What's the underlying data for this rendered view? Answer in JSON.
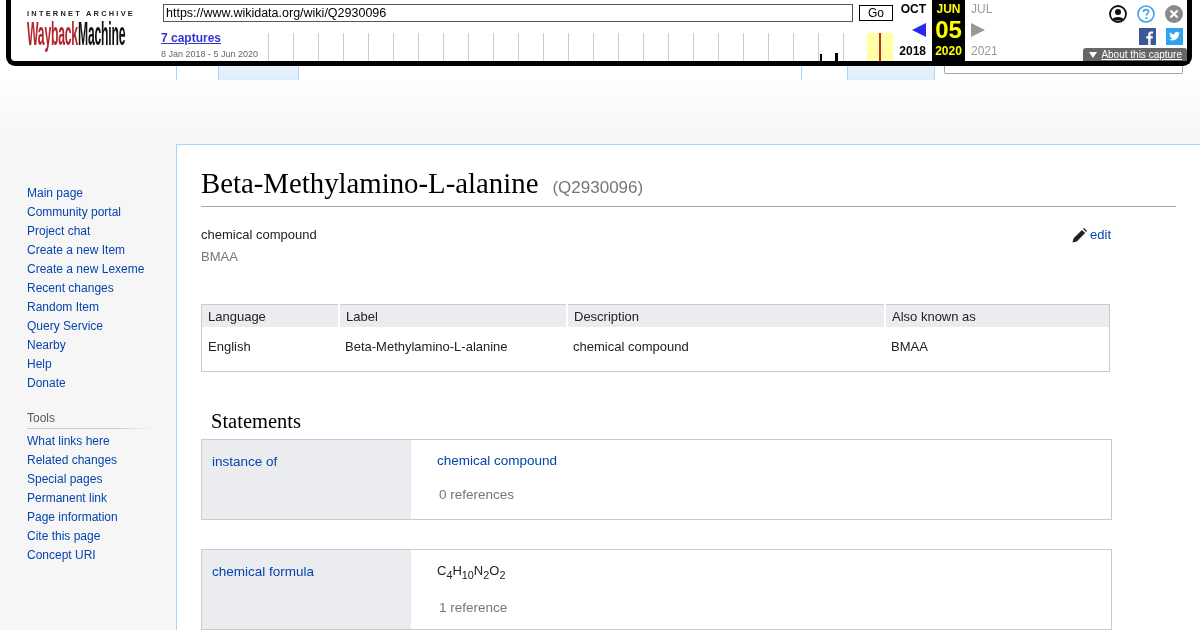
{
  "wayback_toolbar": {
    "logo": {
      "top_line": "INTERNET ARCHIVE",
      "wordmark": [
        "Wayback",
        "Machine"
      ]
    },
    "url_field": {
      "value": "https://www.wikidata.org/wiki/Q2930096"
    },
    "go_button": "Go",
    "captures_link": "7 captures",
    "capture_range": "8 Jan 2018 - 5 Jun 2020",
    "calendar": [
      {
        "kind": "previous",
        "month": "OCT",
        "year": "2018",
        "disabled": false
      },
      {
        "kind": "current",
        "month": "JUN",
        "day": "05",
        "year": "2020",
        "disabled": false
      },
      {
        "kind": "next",
        "month": "JUL",
        "year": "2021",
        "disabled": true
      }
    ],
    "about_capture_button": "About this capture"
  },
  "page_tabs": {
    "left": [
      {
        "selected": true
      },
      {
        "selected": false
      }
    ],
    "right": [
      {
        "selected": true
      },
      {
        "selected": false
      }
    ]
  },
  "sidebar": {
    "navigation": [
      "Main page",
      "Community portal",
      "Project chat",
      "Create a new Item",
      "Create a new Lexeme",
      "Recent changes",
      "Random Item",
      "Query Service",
      "Nearby",
      "Help",
      "Donate"
    ],
    "tools": {
      "heading": "Tools",
      "items": [
        "What links here",
        "Related changes",
        "Special pages",
        "Permanent link",
        "Page information",
        "Cite this page",
        "Concept URI"
      ]
    }
  },
  "item": {
    "label": "Beta-Methylamino-L-alanine",
    "id": "(Q2930096)",
    "description": "chemical compound",
    "aliases": "BMAA",
    "edit_link": "edit"
  },
  "terms_table": {
    "columns": [
      "Language",
      "Label",
      "Description",
      "Also known as"
    ],
    "rows": [
      [
        "English",
        "Beta-Methylamino-L-alanine",
        "chemical compound",
        "BMAA"
      ]
    ]
  },
  "statements": {
    "heading": "Statements",
    "groups": [
      {
        "property": "instance of",
        "kind": "item",
        "value": "chemical compound",
        "references": "0 references"
      },
      {
        "property": "chemical formula",
        "kind": "string",
        "value": "C$_{4}$H$_{10}$N$_{2}$O$_{2}$",
        "references": "1 reference"
      }
    ]
  }
}
